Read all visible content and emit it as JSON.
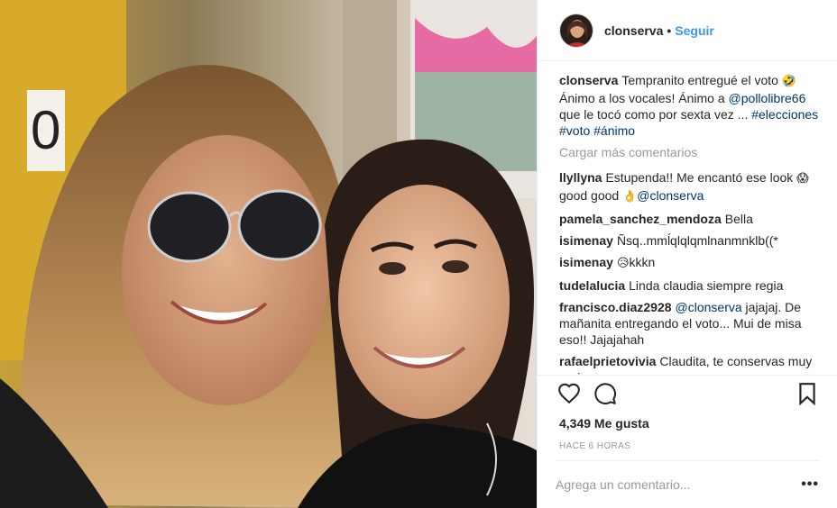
{
  "header": {
    "username": "clonserva",
    "separator": "•",
    "follow_label": "Seguir"
  },
  "caption": {
    "username": "clonserva",
    "text_1": "Tempranito entregué el voto",
    "emoji_1": "🤣",
    "text_2": "Ánimo a los vocales! Ánimo a",
    "mention": "@pollolibre66",
    "text_3": " que le tocó como por sexta vez ... ",
    "tags": [
      "#elecciones",
      "#voto",
      "#ánimo"
    ]
  },
  "load_more": "Cargar más comentarios",
  "comments": [
    {
      "user": "llyllyna",
      "parts": [
        {
          "t": "text",
          "v": "Estupenda!! Me encantó ese look "
        },
        {
          "t": "emoji",
          "v": "😱"
        },
        {
          "t": "text",
          "v": "good good "
        },
        {
          "t": "emoji",
          "v": "👌"
        },
        {
          "t": "link",
          "v": "@clonserva"
        }
      ]
    },
    {
      "user": "pamela_sanchez_mendoza",
      "parts": [
        {
          "t": "text",
          "v": "Bella"
        }
      ]
    },
    {
      "user": "isimenay",
      "parts": [
        {
          "t": "text",
          "v": "Ñsq..mmĺqlqlqmlnanmnklb((*"
        }
      ]
    },
    {
      "user": "isimenay",
      "parts": [
        {
          "t": "emoji",
          "v": "😥"
        },
        {
          "t": "text",
          "v": "kkkn"
        }
      ]
    },
    {
      "user": "tudelalucia",
      "parts": [
        {
          "t": "text",
          "v": "Linda claudia siempre regia"
        }
      ]
    },
    {
      "user": "francisco.diaz2928",
      "parts": [
        {
          "t": "link",
          "v": "@clonserva"
        },
        {
          "t": "text",
          "v": " jajajaj. De mañanita entregando el voto... Mui de misa eso!! Jajajahah"
        }
      ]
    },
    {
      "user": "rafaelprietovivia",
      "parts": [
        {
          "t": "text",
          "v": "Claudita, te conservas muy regia."
        }
      ]
    }
  ],
  "likes": "4,349 Me gusta",
  "timestamp": "HACE 6 HORAS",
  "comment_input": {
    "placeholder": "Agrega un comentario..."
  },
  "more_options": "•••",
  "icons": {
    "like": "heart-icon",
    "comment": "comment-icon",
    "save": "bookmark-icon"
  },
  "colors": {
    "accent": "#3897f0",
    "link": "#003569",
    "muted": "#999999"
  }
}
